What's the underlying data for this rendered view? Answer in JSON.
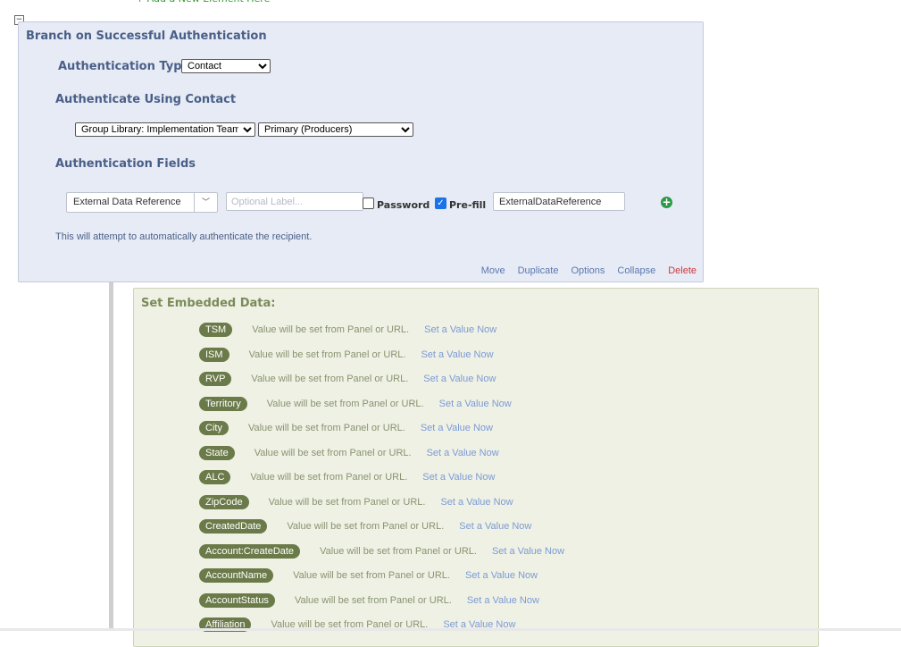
{
  "top_link": "+ Add a New Element Here",
  "branch": {
    "title": "Branch on Successful Authentication",
    "auth_type_label": "Authentication Type:",
    "auth_type_value": "Contact",
    "auth_using_title": "Authenticate Using Contact",
    "library_value": "Group Library: Implementation Team",
    "panel_value": "Primary (Producers)",
    "fields_title": "Authentication Fields",
    "field_type": "External Data Reference",
    "label_placeholder": "Optional Label...",
    "password_label": "Password",
    "password_checked": false,
    "prefill_label": "Pre-fill",
    "prefill_checked": true,
    "prefill_value": "ExternalDataReference",
    "note": "This will attempt to automatically authenticate the recipient.",
    "actions": {
      "move": "Move",
      "duplicate": "Duplicate",
      "options": "Options",
      "collapse": "Collapse",
      "delete": "Delete"
    }
  },
  "embedded": {
    "title": "Set Embedded Data:",
    "value_text": "Value will be set from Panel or URL.",
    "link_text": "Set a Value Now",
    "fields": [
      "TSM",
      "ISM",
      "RVP",
      "Territory",
      "City",
      "State",
      "ALC",
      "ZipCode",
      "CreatedDate",
      "Account:CreateDate",
      "AccountName",
      "AccountStatus",
      "Affiliation"
    ]
  }
}
